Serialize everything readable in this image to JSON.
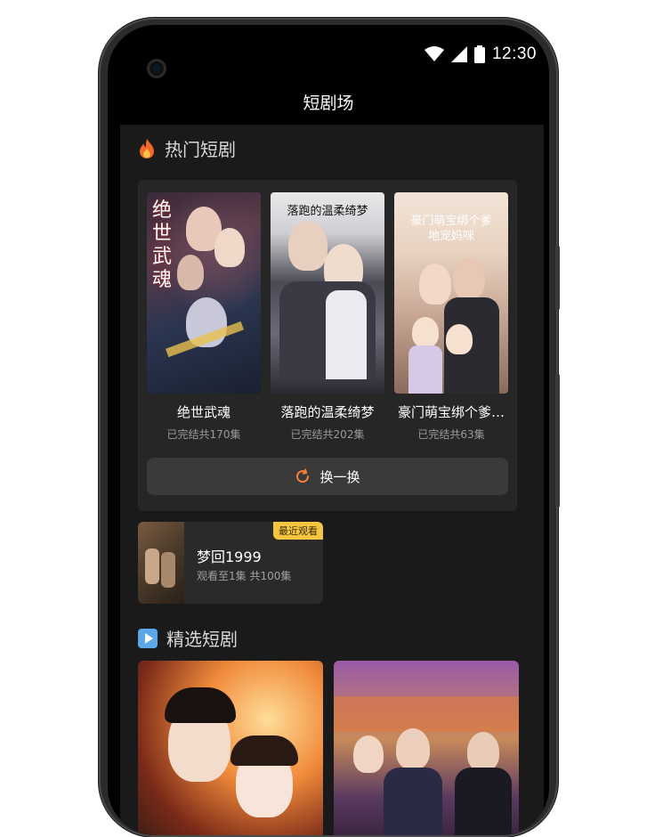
{
  "status_bar": {
    "time": "12:30"
  },
  "header": {
    "title": "短剧场"
  },
  "hot_section": {
    "title": "热门短剧",
    "items": [
      {
        "name": "绝世武魂",
        "episodes": "已完结共170集",
        "poster_text": "绝世武魂"
      },
      {
        "name": "落跑的温柔绮梦",
        "episodes": "已完结共202集",
        "poster_text": "落跑的温柔绮梦"
      },
      {
        "name": "豪门萌宝绑个爹…",
        "episodes": "已完结共63集",
        "poster_text": "豪门萌宝绑个爹地宠妈咪"
      }
    ],
    "refresh_label": "换一换"
  },
  "recent": {
    "badge": "最近观看",
    "title": "梦回1999",
    "meta": "观看至1集 共100集"
  },
  "featured_section": {
    "title": "精选短剧"
  },
  "colors": {
    "accent": "#f5813a",
    "badge": "#f5c542",
    "background": "#1a1a1a"
  }
}
